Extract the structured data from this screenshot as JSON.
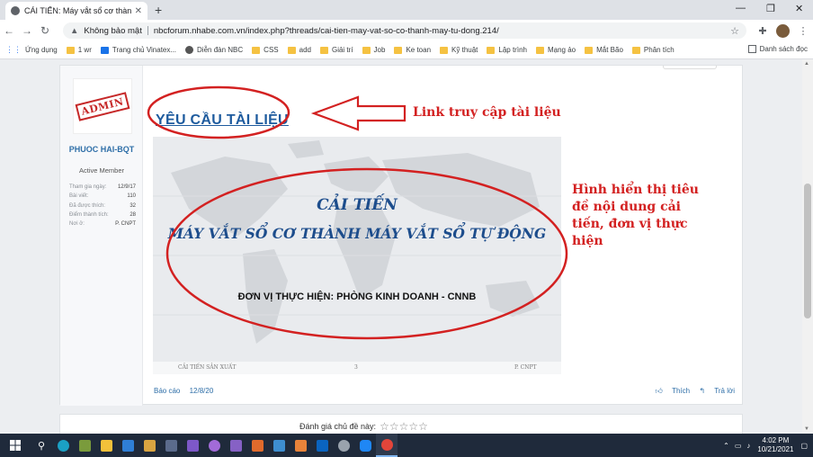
{
  "browser": {
    "tab_title": "CẢI TIẾN: Máy vắt sổ cơ thành m",
    "tab_close": "✕",
    "new_tab": "+",
    "security_label": "Không bảo mật",
    "url": "nbcforum.nhabe.com.vn/index.php?threads/cai-tien-may-vat-so-co-thanh-may-tu-dong.214/",
    "window_controls": [
      "—",
      "❐",
      "✕"
    ]
  },
  "bookmarks": [
    {
      "label": "Ứng dụng",
      "icon": "apps-grid-icon"
    },
    {
      "label": "1 wr",
      "icon": "folder-icon"
    },
    {
      "label": "Trang chủ Vinatex...",
      "icon": "bookmark-icon"
    },
    {
      "label": "Diễn đàn NBC",
      "icon": "globe-icon"
    },
    {
      "label": "CSS",
      "icon": "folder-icon"
    },
    {
      "label": "add",
      "icon": "folder-icon"
    },
    {
      "label": "Giải trí",
      "icon": "folder-icon"
    },
    {
      "label": "Job",
      "icon": "folder-icon"
    },
    {
      "label": "Ke toan",
      "icon": "folder-icon"
    },
    {
      "label": "Kỹ thuật",
      "icon": "folder-icon"
    },
    {
      "label": "Lập trình",
      "icon": "folder-icon"
    },
    {
      "label": "Mạng ảo",
      "icon": "folder-icon"
    },
    {
      "label": "Mắt Bão",
      "icon": "folder-icon"
    },
    {
      "label": "Phân tích",
      "icon": "folder-icon"
    }
  ],
  "bookmarks_right": "Danh sách đọc",
  "user": {
    "avatar_text": "ADMIN",
    "name": "PHUOC HAI-BQT",
    "title": "Active Member",
    "stats": [
      {
        "label": "Tham gia ngày:",
        "value": "12/9/17"
      },
      {
        "label": "Bài viết:",
        "value": "110"
      },
      {
        "label": "Đã được thích:",
        "value": "32"
      },
      {
        "label": "Điểm thành tích:",
        "value": "28"
      },
      {
        "label": "Nơi ở:",
        "value": "P. CNPT"
      }
    ]
  },
  "post": {
    "request_link": "YÊU CẦU TÀI LIỆU",
    "slide_title1": "CẢI TIẾN",
    "slide_title2": "MÁY VẮT SỔ CƠ THÀNH MÁY VẮT SỔ TỰ ĐỘNG",
    "slide_unit": "ĐƠN VỊ THỰC HIỆN: PHÒNG KINH DOANH - CNNB",
    "slide_footer_left": "CẢI TIẾN SẢN XUẤT",
    "slide_footer_mid": "3",
    "slide_footer_right": "P. CNPT",
    "report": "Báo cáo",
    "date": "12/8/20",
    "like": "Thích",
    "reply": "Trả lời"
  },
  "annotations": {
    "link_note": "Link truy cập tài liệu",
    "image_note": "Hình hiển thị tiêu đề nội dung cải tiến, đơn vị thực hiện"
  },
  "rating": {
    "label": "Đánh giá chủ đề này:",
    "stars": "☆☆☆☆☆"
  },
  "taskbar": {
    "time": "4:02 PM",
    "date": "10/21/2021"
  },
  "colors": {
    "annotation_red": "#d32121",
    "link_blue": "#1e5b9e",
    "slide_title_blue": "#1d4d8c"
  }
}
